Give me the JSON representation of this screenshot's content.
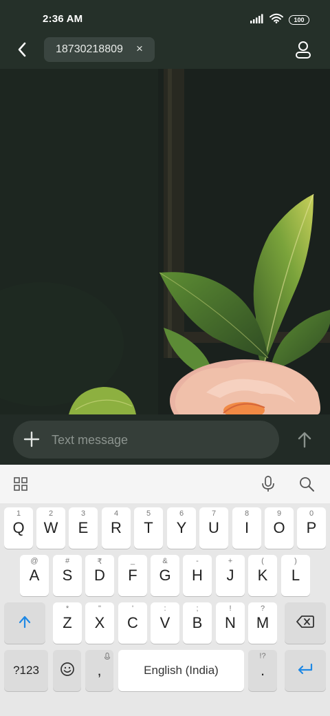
{
  "status_bar": {
    "time": "2:36 AM",
    "battery": "100",
    "icons": [
      "signal-icon",
      "wifi-icon",
      "battery-icon"
    ]
  },
  "top_bar": {
    "recipient": "18730218809",
    "chip_close": "×",
    "icons": [
      "back-arrow-icon",
      "close-icon",
      "contact-icon"
    ]
  },
  "compose": {
    "placeholder": "Text message",
    "icons": [
      "plus-icon",
      "send-arrow-icon"
    ]
  },
  "keyboard": {
    "toolbar_icons": [
      "apps-grid-icon",
      "microphone-icon",
      "search-icon"
    ],
    "rows": [
      {
        "keys": [
          {
            "main": "Q",
            "hint": "1"
          },
          {
            "main": "W",
            "hint": "2"
          },
          {
            "main": "E",
            "hint": "3"
          },
          {
            "main": "R",
            "hint": "4"
          },
          {
            "main": "T",
            "hint": "5"
          },
          {
            "main": "Y",
            "hint": "6"
          },
          {
            "main": "U",
            "hint": "7"
          },
          {
            "main": "I",
            "hint": "8"
          },
          {
            "main": "O",
            "hint": "9"
          },
          {
            "main": "P",
            "hint": "0"
          }
        ]
      },
      {
        "keys": [
          {
            "main": "A",
            "hint": "@"
          },
          {
            "main": "S",
            "hint": "#"
          },
          {
            "main": "D",
            "hint": "₹"
          },
          {
            "main": "F",
            "hint": "_"
          },
          {
            "main": "G",
            "hint": "&"
          },
          {
            "main": "H",
            "hint": "-"
          },
          {
            "main": "J",
            "hint": "+"
          },
          {
            "main": "K",
            "hint": "("
          },
          {
            "main": "L",
            "hint": ")"
          }
        ]
      },
      {
        "keys": [
          {
            "main": "Z",
            "hint": "*"
          },
          {
            "main": "X",
            "hint": "\""
          },
          {
            "main": "C",
            "hint": "'"
          },
          {
            "main": "V",
            "hint": ":"
          },
          {
            "main": "B",
            "hint": ";"
          },
          {
            "main": "N",
            "hint": "!"
          },
          {
            "main": "M",
            "hint": "?"
          }
        ]
      }
    ],
    "bottom": {
      "symbols_label": "?123",
      "comma": ",",
      "space_label": "English (India)",
      "period": ".",
      "period_hint": "!?"
    },
    "special_icons": [
      "shift-icon",
      "backspace-icon",
      "emoji-icon",
      "enter-icon",
      "mic-hint-icon"
    ],
    "accent_color": "#1e88e5"
  }
}
